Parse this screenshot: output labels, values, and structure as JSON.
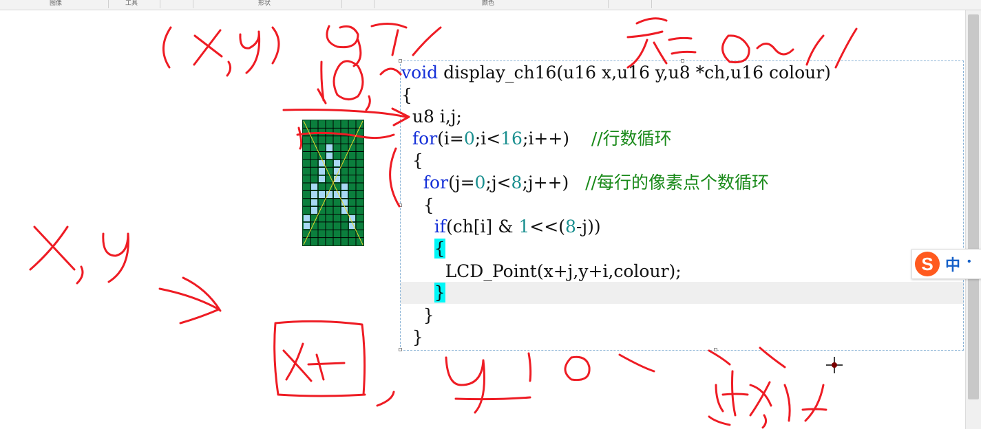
{
  "ribbon": {
    "groups": [
      "图像",
      "工具",
      "形状",
      "颜色"
    ]
  },
  "code": {
    "lines": [
      {
        "indent": "",
        "parts": [
          {
            "t": "void",
            "c": "kw"
          },
          {
            "t": " display_ch16(u16 x,u16 y,u8 *ch,u16 colour)",
            "c": ""
          }
        ]
      },
      {
        "indent": "",
        "parts": [
          {
            "t": "{",
            "c": ""
          }
        ]
      },
      {
        "indent": "  ",
        "parts": [
          {
            "t": "u8 i,j;",
            "c": ""
          }
        ]
      },
      {
        "indent": "  ",
        "parts": [
          {
            "t": "for",
            "c": "kw"
          },
          {
            "t": "(i=",
            "c": ""
          },
          {
            "t": "0",
            "c": "num"
          },
          {
            "t": ";i<",
            "c": ""
          },
          {
            "t": "16",
            "c": "num"
          },
          {
            "t": ";i++)    ",
            "c": ""
          },
          {
            "t": "//行数循环",
            "c": "cmt"
          }
        ]
      },
      {
        "indent": "  ",
        "parts": [
          {
            "t": "{",
            "c": ""
          }
        ]
      },
      {
        "indent": "    ",
        "parts": [
          {
            "t": "for",
            "c": "kw"
          },
          {
            "t": "(j=",
            "c": ""
          },
          {
            "t": "0",
            "c": "num"
          },
          {
            "t": ";j<",
            "c": ""
          },
          {
            "t": "8",
            "c": "num"
          },
          {
            "t": ";j++)   ",
            "c": ""
          },
          {
            "t": "//每行的像素点个数循环",
            "c": "cmt"
          }
        ]
      },
      {
        "indent": "    ",
        "parts": [
          {
            "t": "{",
            "c": ""
          }
        ]
      },
      {
        "indent": "      ",
        "parts": [
          {
            "t": "if",
            "c": "kw"
          },
          {
            "t": "(ch[i] & ",
            "c": ""
          },
          {
            "t": "1",
            "c": "num"
          },
          {
            "t": "<<(",
            "c": ""
          },
          {
            "t": "8",
            "c": "num"
          },
          {
            "t": "-j))",
            "c": ""
          }
        ]
      },
      {
        "indent": "      ",
        "parts": [
          {
            "t": "{",
            "c": "brace-hl"
          }
        ]
      },
      {
        "indent": "        ",
        "parts": [
          {
            "t": "LCD_Point(x+j,y+i,colour);",
            "c": ""
          }
        ]
      },
      {
        "indent": "      ",
        "parts": [
          {
            "t": "}",
            "c": "brace-hl"
          }
        ]
      },
      {
        "indent": "    ",
        "parts": [
          {
            "t": "}",
            "c": ""
          }
        ]
      },
      {
        "indent": "  ",
        "parts": [
          {
            "t": "}",
            "c": ""
          }
        ]
      }
    ]
  },
  "pixel_char": {
    "cols": 8,
    "rows": 16,
    "on_rows": [
      [],
      [],
      [],
      [
        3
      ],
      [
        3
      ],
      [
        2,
        4
      ],
      [
        2,
        4
      ],
      [
        2,
        4
      ],
      [
        1,
        5
      ],
      [
        1,
        2,
        3,
        4,
        5
      ],
      [
        1,
        5
      ],
      [
        1,
        5
      ],
      [
        0,
        6
      ],
      [
        0,
        6
      ],
      [],
      []
    ]
  },
  "ime": {
    "logo": "S",
    "mode": "中",
    "extra": "•"
  },
  "colors": {
    "keyword": "#1530d8",
    "number": "#1a8f8f",
    "comment": "#1a8a1a",
    "ink": "#ee1c24",
    "grid_bg": "#0b7f3d",
    "pixel_on": "#a9d8f5",
    "brace_highlight": "#00f7f7"
  }
}
